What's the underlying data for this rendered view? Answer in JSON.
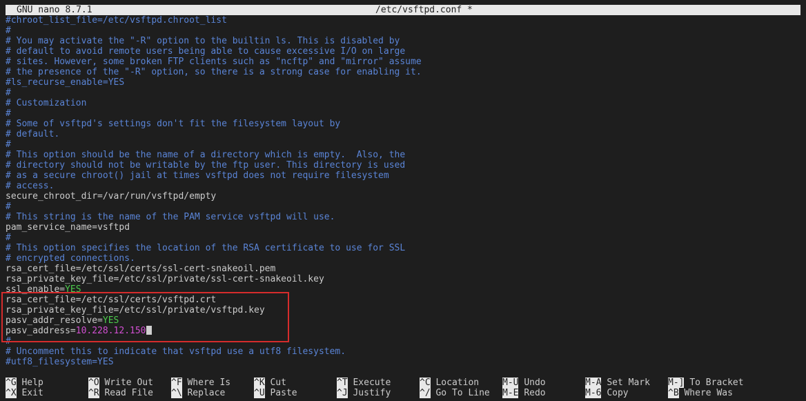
{
  "titlebar": {
    "app": "GNU nano 8.7.1",
    "file": "/etc/vsftpd.conf *"
  },
  "lines": [
    {
      "type": "comment",
      "text": "#chroot_list_file=/etc/vsftpd.chroot_list"
    },
    {
      "type": "comment",
      "text": "#"
    },
    {
      "type": "comment",
      "text": "# You may activate the \"-R\" option to the builtin ls. This is disabled by"
    },
    {
      "type": "comment",
      "text": "# default to avoid remote users being able to cause excessive I/O on large"
    },
    {
      "type": "comment",
      "text": "# sites. However, some broken FTP clients such as \"ncftp\" and \"mirror\" assume"
    },
    {
      "type": "comment",
      "text": "# the presence of the \"-R\" option, so there is a strong case for enabling it."
    },
    {
      "type": "comment",
      "text": "#ls_recurse_enable=YES"
    },
    {
      "type": "comment",
      "text": "#"
    },
    {
      "type": "comment",
      "text": "# Customization"
    },
    {
      "type": "comment",
      "text": "#"
    },
    {
      "type": "comment",
      "text": "# Some of vsftpd's settings don't fit the filesystem layout by"
    },
    {
      "type": "comment",
      "text": "# default."
    },
    {
      "type": "comment",
      "text": "#"
    },
    {
      "type": "comment",
      "text": "# This option should be the name of a directory which is empty.  Also, the"
    },
    {
      "type": "comment",
      "text": "# directory should not be writable by the ftp user. This directory is used"
    },
    {
      "type": "comment",
      "text": "# as a secure chroot() jail at times vsftpd does not require filesystem"
    },
    {
      "type": "comment",
      "text": "# access."
    },
    {
      "type": "kv",
      "key": "secure_chroot_dir=",
      "value": "/var/run/vsftpd/empty",
      "vtype": "plain"
    },
    {
      "type": "comment",
      "text": "#"
    },
    {
      "type": "comment",
      "text": "# This string is the name of the PAM service vsftpd will use."
    },
    {
      "type": "kv",
      "key": "pam_service_name=",
      "value": "vsftpd",
      "vtype": "plain"
    },
    {
      "type": "comment",
      "text": "#"
    },
    {
      "type": "comment",
      "text": "# This option specifies the location of the RSA certificate to use for SSL"
    },
    {
      "type": "comment",
      "text": "# encrypted connections."
    },
    {
      "type": "kv",
      "key": "rsa_cert_file=",
      "value": "/etc/ssl/certs/ssl-cert-snakeoil.pem",
      "vtype": "plain"
    },
    {
      "type": "kv",
      "key": "rsa_private_key_file=",
      "value": "/etc/ssl/private/ssl-cert-snakeoil.key",
      "vtype": "plain"
    },
    {
      "type": "kv",
      "key": "ssl_enable=",
      "value": "YES",
      "vtype": "yes"
    },
    {
      "type": "kv",
      "key": "rsa_cert_file=",
      "value": "/etc/ssl/certs/vsftpd.crt",
      "vtype": "plain"
    },
    {
      "type": "kv",
      "key": "rsa_private_key_file=",
      "value": "/etc/ssl/private/vsftpd.key",
      "vtype": "plain"
    },
    {
      "type": "kv",
      "key": "pasv_addr_resolve=",
      "value": "YES",
      "vtype": "yes"
    },
    {
      "type": "kv",
      "key": "pasv_address=",
      "value": "10.228.12.150",
      "vtype": "ip",
      "cursor": true
    },
    {
      "type": "comment",
      "text": "#"
    },
    {
      "type": "comment",
      "text": "# Uncomment this to indicate that vsftpd use a utf8 filesystem."
    },
    {
      "type": "comment",
      "text": "#utf8_filesystem=YES"
    }
  ],
  "shortcuts": [
    {
      "key": "^G",
      "label": "Help"
    },
    {
      "key": "^X",
      "label": "Exit"
    },
    {
      "key": "^O",
      "label": "Write Out"
    },
    {
      "key": "^R",
      "label": "Read File"
    },
    {
      "key": "^F",
      "label": "Where Is"
    },
    {
      "key": "^\\",
      "label": "Replace"
    },
    {
      "key": "^K",
      "label": "Cut"
    },
    {
      "key": "^U",
      "label": "Paste"
    },
    {
      "key": "^T",
      "label": "Execute"
    },
    {
      "key": "^J",
      "label": "Justify"
    },
    {
      "key": "^C",
      "label": "Location"
    },
    {
      "key": "^/",
      "label": "Go To Line"
    },
    {
      "key": "M-U",
      "label": "Undo"
    },
    {
      "key": "M-E",
      "label": "Redo"
    },
    {
      "key": "M-A",
      "label": "Set Mark"
    },
    {
      "key": "M-6",
      "label": "Copy"
    },
    {
      "key": "M-]",
      "label": "To Bracket"
    },
    {
      "key": "^B",
      "label": "Where Was"
    }
  ],
  "colors": {
    "background": "#1e1e1e",
    "comment": "#5a84d6",
    "yes": "#4ccb4c",
    "ip": "#d14fd1",
    "highlight_border": "#d62c2c"
  }
}
